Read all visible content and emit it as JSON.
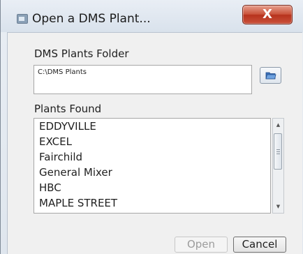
{
  "window": {
    "title": "Open a DMS Plant...",
    "close_glyph": "X",
    "icon": "app-window-icon"
  },
  "folder": {
    "label": "DMS Plants Folder",
    "value": "C:\\DMS Plants",
    "browse_icon": "folder-open-icon"
  },
  "plants": {
    "label": "Plants Found",
    "items": [
      "EDDYVILLE",
      "EXCEL",
      "Fairchild",
      "General Mixer",
      "HBC",
      "MAPLE STREET"
    ]
  },
  "buttons": {
    "open_label": "Open",
    "cancel_label": "Cancel",
    "open_enabled": false
  },
  "colors": {
    "close_button": "#c9523a",
    "disabled_text": "#9c9c9c"
  }
}
